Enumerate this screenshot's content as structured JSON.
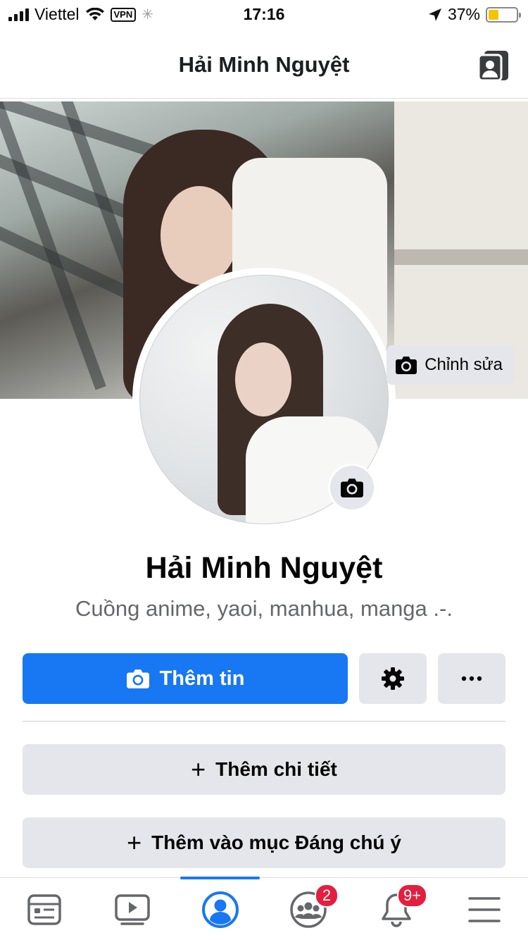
{
  "status_bar": {
    "carrier": "Viettel",
    "vpn": "VPN",
    "time": "17:16",
    "battery": "37%",
    "battery_level": 0.37
  },
  "header": {
    "title": "Hải Minh Nguyệt"
  },
  "cover": {
    "edit_label": "Chỉnh sửa"
  },
  "profile": {
    "name": "Hải Minh Nguyệt",
    "bio": "Cuồng anime, yaoi, manhua, manga .-."
  },
  "actions": {
    "add_story_label": "Thêm tin",
    "add_details_label": "Thêm chi tiết",
    "add_featured_label": "Thêm vào mục Đáng chú ý"
  },
  "tabbar": {
    "groups_badge": "2",
    "notifications_badge": "9+"
  },
  "colors": {
    "accent": "#1877f2",
    "badge": "#e41e3f",
    "button_bg": "#e4e6eb"
  }
}
